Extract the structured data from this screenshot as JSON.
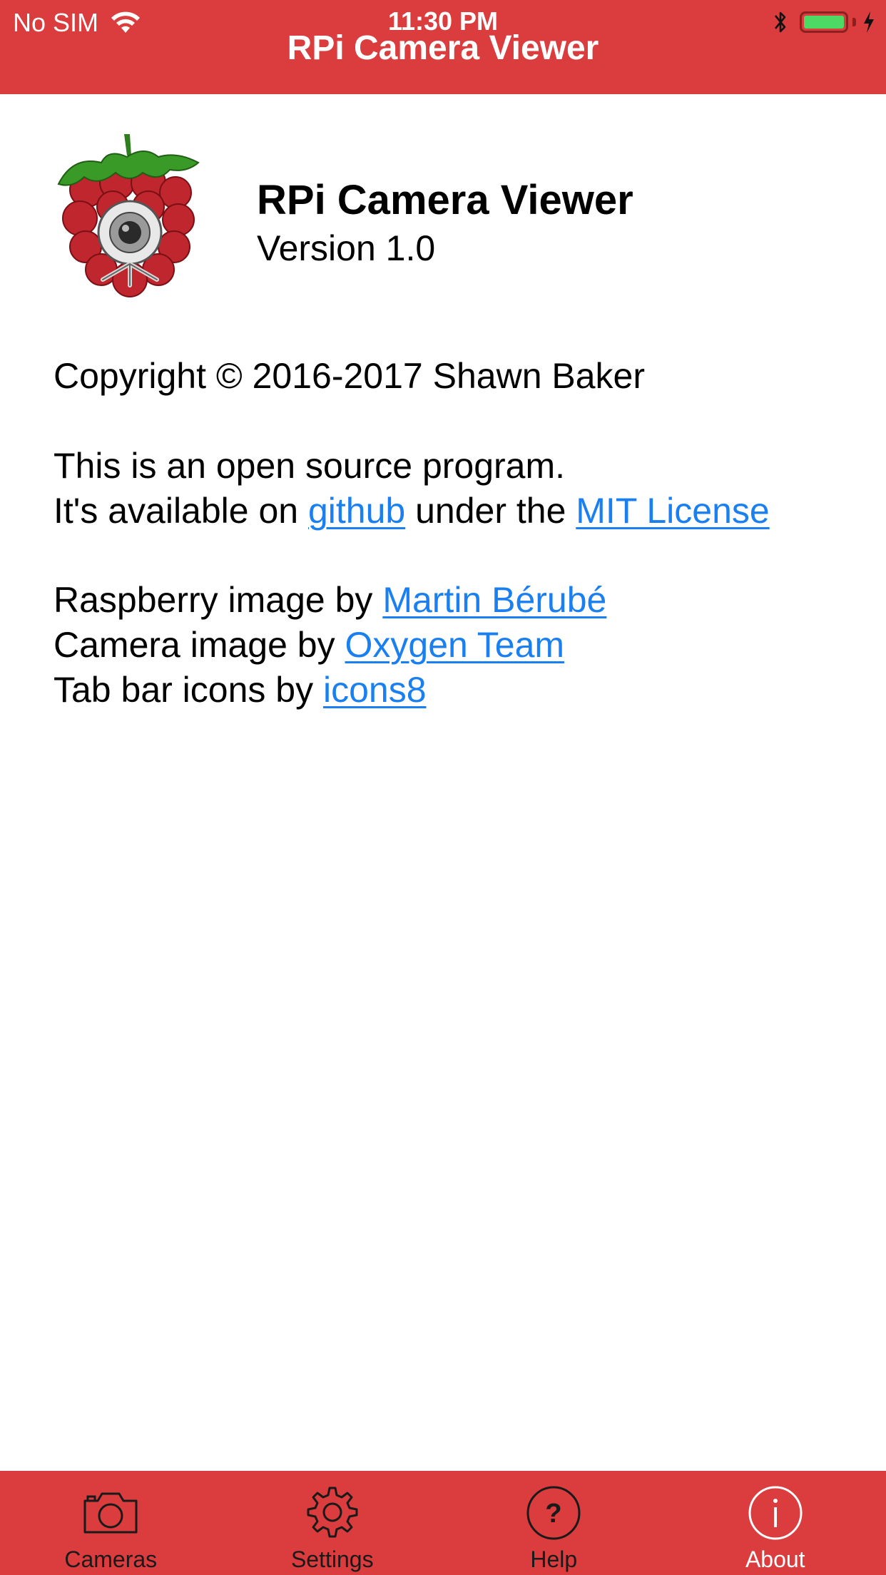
{
  "status_bar": {
    "carrier": "No SIM",
    "time": "11:30 PM",
    "battery_level": 1.0
  },
  "nav": {
    "title": "RPi Camera Viewer"
  },
  "about": {
    "app_name": "RPi Camera Viewer",
    "version": "Version 1.0",
    "copyright": "Copyright © 2016-2017 Shawn Baker",
    "open_source_line": "This is an open source program.",
    "availability": {
      "prefix": "It's available on ",
      "github_link": "github",
      "middle": " under the ",
      "license_link": "MIT License"
    },
    "credits": {
      "raspberry_prefix": "Raspberry image by ",
      "raspberry_link": "Martin Bérubé",
      "camera_prefix": "Camera image by ",
      "camera_link": "Oxygen Team",
      "tabbar_prefix": "Tab bar icons by ",
      "tabbar_link": "icons8"
    }
  },
  "tabs": [
    {
      "label": "Cameras",
      "icon": "camera-icon",
      "active": false
    },
    {
      "label": "Settings",
      "icon": "gear-icon",
      "active": false
    },
    {
      "label": "Help",
      "icon": "help-icon",
      "active": false
    },
    {
      "label": "About",
      "icon": "info-icon",
      "active": true
    }
  ],
  "colors": {
    "brand_red": "#db3c3d",
    "link_blue": "#1a7ff0",
    "battery_green": "#4cd964"
  }
}
